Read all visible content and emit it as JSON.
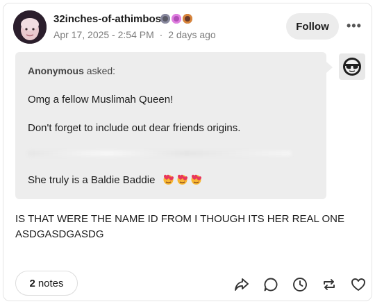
{
  "post": {
    "blog_name": "32inches-of-athimbos",
    "timestamp": "Apr 17, 2025 - 2:54 PM",
    "separator": "·",
    "relative_time": "2 days ago",
    "follow_label": "Follow",
    "more_label": "•••",
    "badges": [
      "badge-icon",
      "badge-icon",
      "badge-icon"
    ]
  },
  "ask": {
    "asker": "Anonymous",
    "asked_label": "asked:",
    "line1": "Omg a fellow Muslimah Queen!",
    "line2": "Don't forget to include out dear friends origins.",
    "line3": "She truly is a Baldie Baddie",
    "emoji_icon": "heart-face-emoji-icon"
  },
  "reply": {
    "text": "IS THAT WERE THE NAME ID FROM I THOUGH ITS HER REAL ONE ASDGASDGASDG"
  },
  "footer": {
    "notes_count": "2",
    "notes_label": "notes",
    "actions": [
      "share-icon",
      "reply-icon",
      "schedule-icon",
      "reblog-icon",
      "like-icon"
    ]
  },
  "colors": {
    "bubble": "#ededed",
    "muted_text": "#7c7c7c",
    "follow_bg": "#ececec"
  }
}
